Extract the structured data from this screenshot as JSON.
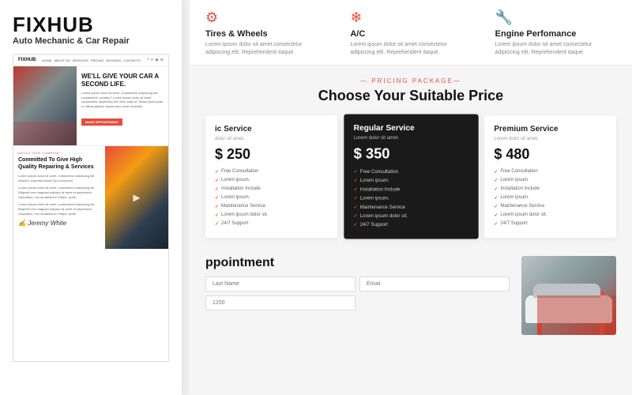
{
  "brand": {
    "name": "FIXHUB",
    "tagline": "Auto Mechanic & Car Repair"
  },
  "nav": {
    "logo": "FIXHUB",
    "links": [
      "HOME",
      "ABOUT US",
      "SERVICES",
      "PRICING",
      "BOOKING",
      "CONTACTS"
    ]
  },
  "hero": {
    "title": "WE'LL GIVE YOUR CAR A SECOND LIFE.",
    "text": "Lorem ipsum dolor sit amet, consectetur adipiscing elit. Laudantium, pariatur? Lorem ipsum dolor sit amet consectetur adipiscing elit. Illum sapil ut. Minus quod quas ut officia adipisci aspernores modi necesitis.",
    "cta": "MAKE APPOINTMENT"
  },
  "about": {
    "tag": "ABOUT OUR COMPANY",
    "title": "Committed To Give High Quality Repairing & Services",
    "paragraphs": [
      "Lorem ipsum dolor sit amet, consectetur adipiscing elit. Nesctur, expedita totam! Quo excepturi.",
      "Lorem ipsum dolor sit amet, consectetur adipiscing elit. Eligendi rem magnam adipisci sit amet et aspernatur voluptatus, non laudantium! Saeps, qvod!",
      "Lorem ipsum dolor sit amet, consectetur adipiscing elit. Eligendi rem magnam adipisci sit amet et aspernatur voluptatus, non laudantium! Saeps, qvod!"
    ],
    "signature": "Jeremy White",
    "signature_label": "Jeremy White"
  },
  "services": [
    {
      "icon": "⚙",
      "title": "Tires & Wheels",
      "text": "Lorem ipsum dolor sit amet consectetur adipiscing elit. Reprehenderit itaque."
    },
    {
      "icon": "❄",
      "title": "A/C",
      "text": "Lorem ipsum dolor sit amet consectetur adipiscing elit. Reprehenderit itaque."
    },
    {
      "icon": "🔧",
      "title": "Engine Perfomance",
      "text": "Lorem ipsum dolor sit amet consectetur adipiscing elit. Reprehenderit itaque."
    }
  ],
  "pricing": {
    "tag": "PRICING PACKAGE",
    "title": "Choose Your Suitable Price",
    "cards": [
      {
        "title": "ic Service",
        "description": "dolor sit amet.",
        "price": "$ 250",
        "features": [
          "Free Consultation",
          "Lorem ipsum.",
          "Installation Include",
          "Lorem ipsum.",
          "Maintenance Service",
          "Lorem ipsum dolor sit.",
          "24/7 Support"
        ],
        "featured": false
      },
      {
        "title": "Regular Service",
        "description": "Lorem dolor sit amet.",
        "price": "$ 350",
        "features": [
          "Free Consultation",
          "Lorem ipsum.",
          "Installation Include",
          "Lorem ipsum.",
          "Maintenance Service",
          "Lorem ipsum dolor sit.",
          "24/7 Support"
        ],
        "featured": true
      },
      {
        "title": "Premium Service",
        "description": "Lorem dolor sit amet.",
        "price": "$ 480",
        "features": [
          "Free Consultation",
          "Lorem ipsum.",
          "Installation Include",
          "Lorem ipsum.",
          "Maintenance Service",
          "Lorem ipsum dolor sit.",
          "24/7 Support"
        ],
        "featured": false
      }
    ]
  },
  "appointment": {
    "title": "ppointment",
    "fields": [
      {
        "placeholder": "Last Name",
        "full": false
      },
      {
        "placeholder": "Email",
        "full": false
      },
      {
        "placeholder": "1200",
        "full": false
      }
    ]
  }
}
